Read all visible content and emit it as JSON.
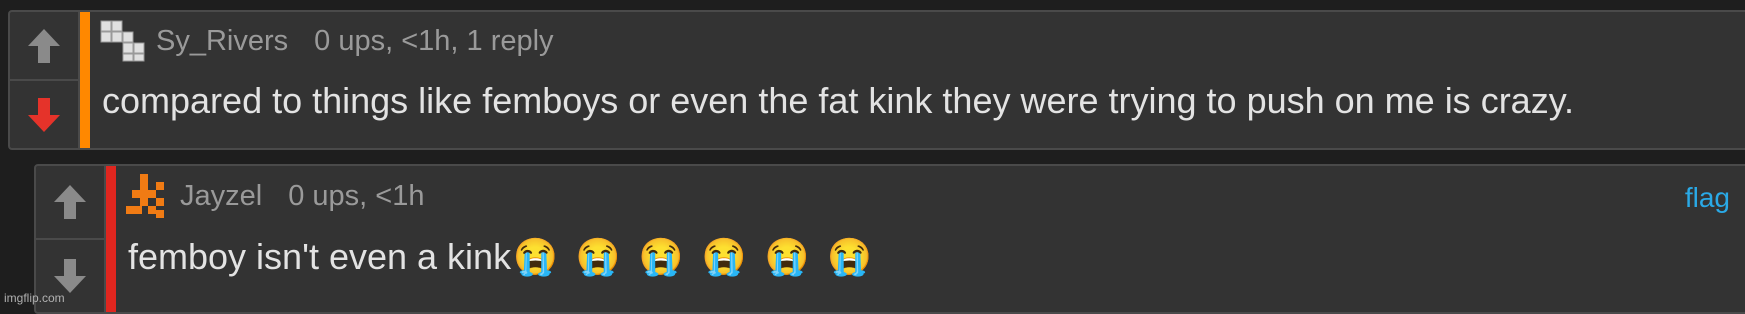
{
  "colors": {
    "panel_bg": "#333333",
    "panel_border": "#4a4a4a",
    "arrow_neutral": "#8a8a8a",
    "downvote_active": "#e5332a",
    "bar_comment1": "#ff8800",
    "bar_comment2": "#e0261f",
    "username": "#9a9a9a",
    "flag_link": "#2aa9e6",
    "avatar_orange": "#f07b14"
  },
  "comment1": {
    "username": "Sy_Rivers",
    "meta": "0 ups, <1h, 1 reply",
    "text": "compared to things like femboys or even the fat kink they were trying to push on me is crazy.",
    "upvote_icon": "arrow-up-icon",
    "downvote_icon": "arrow-down-icon",
    "downvote_active": true
  },
  "comment2": {
    "username": "Jayzel",
    "meta": "0 ups, <1h",
    "flag": "flag",
    "text": "femboy isn't even a kink",
    "emoji": [
      "😭",
      "😭",
      "😭",
      "😭",
      "😭",
      "😭"
    ],
    "upvote_icon": "arrow-up-icon",
    "downvote_icon": "arrow-down-icon"
  },
  "watermark": "imgflip.com"
}
